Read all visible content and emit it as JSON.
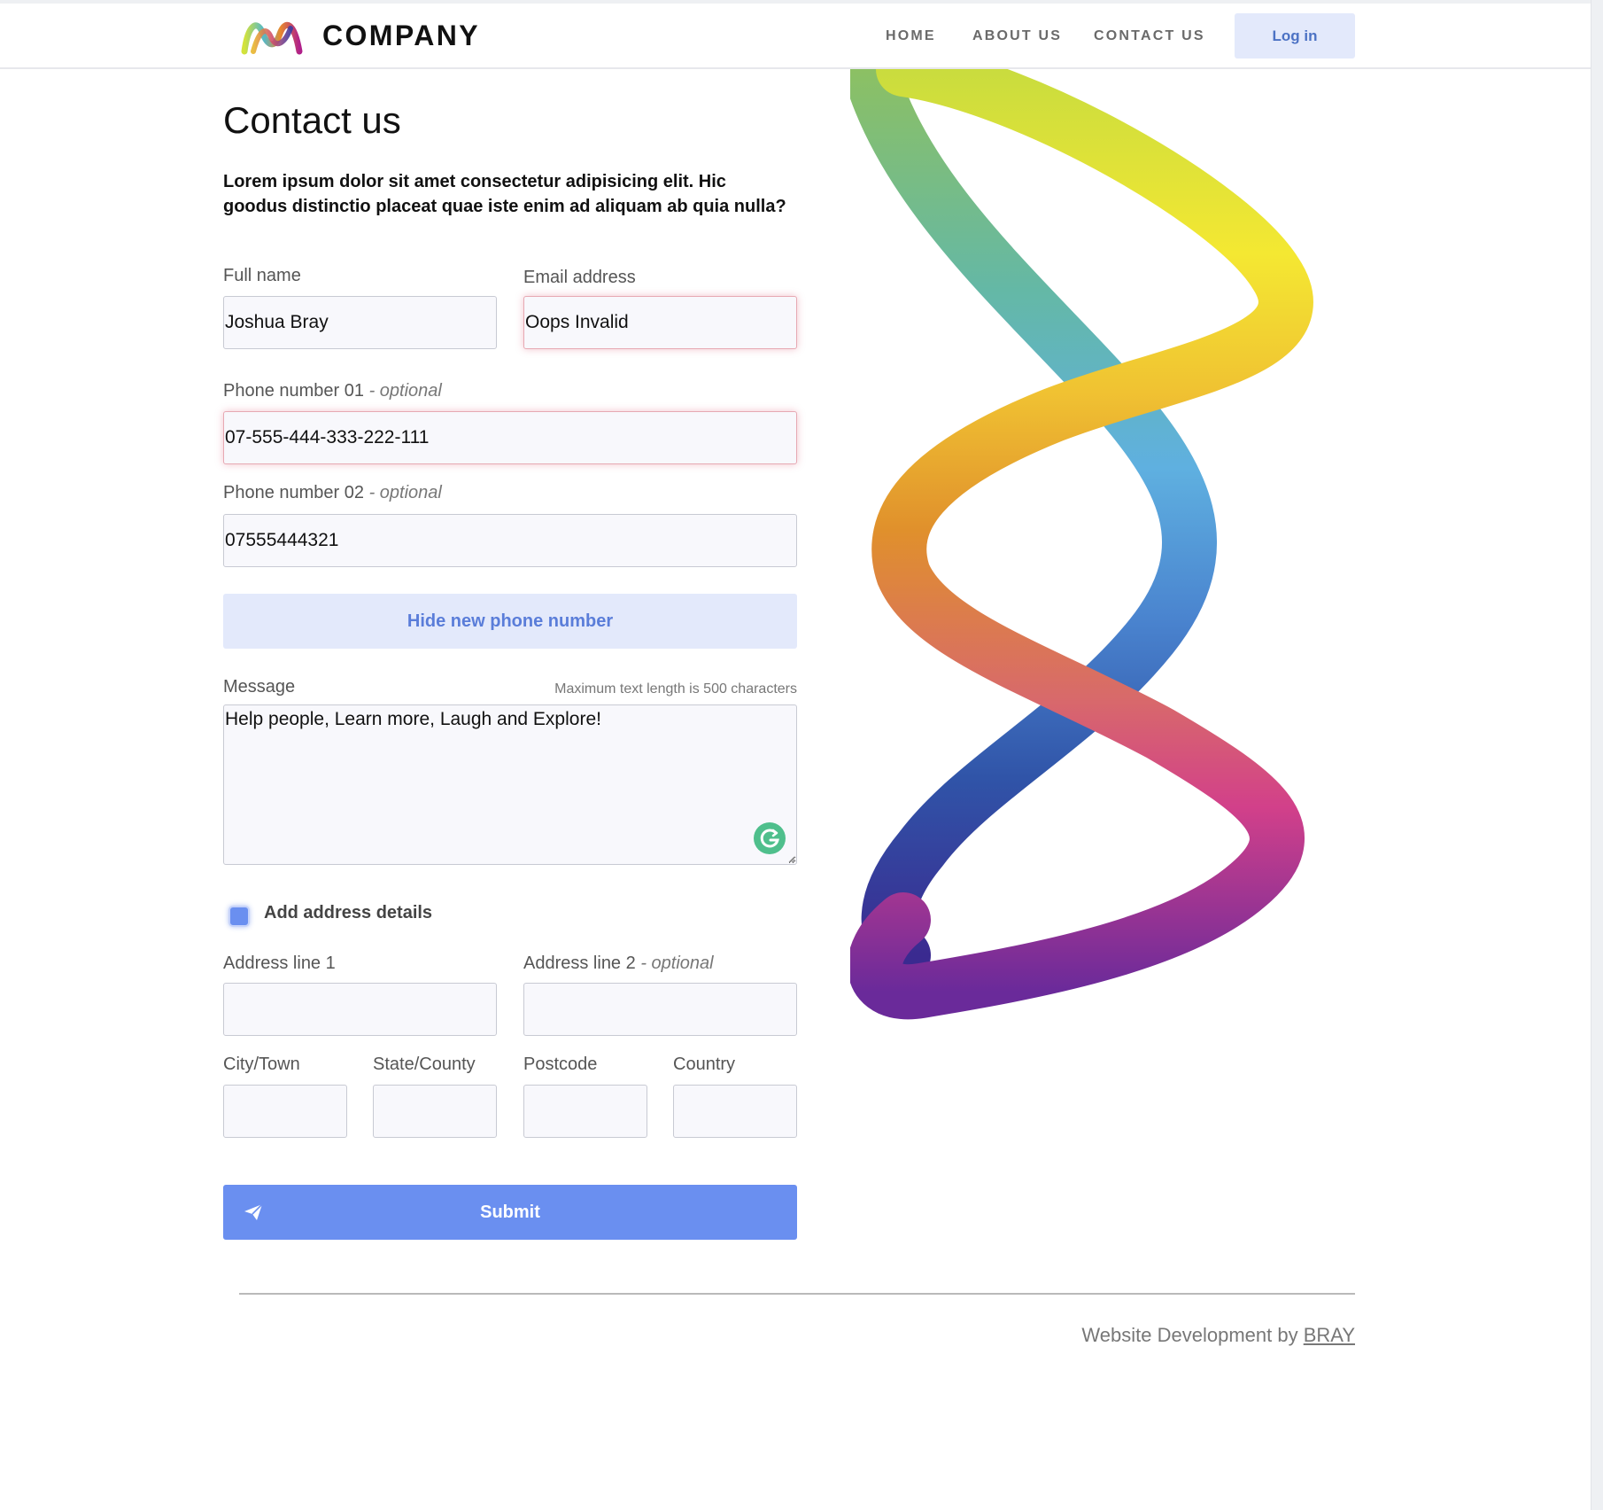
{
  "brand": {
    "name": "COMPANY",
    "colors": {
      "accent": "#6a8ff0",
      "soft_accent": "#e3e9fb",
      "link_text": "#4c72c4",
      "invalid_glow": "#d6506e"
    }
  },
  "nav": {
    "items": [
      {
        "label": "HOME"
      },
      {
        "label": "ABOUT US"
      },
      {
        "label": "CONTACT US"
      }
    ],
    "login_label": "Log in"
  },
  "page": {
    "title": "Contact us",
    "intro": "Lorem ipsum dolor sit amet consectetur adipisicing elit. Hic goodus distinctio placeat quae iste enim ad aliquam ab quia nulla?"
  },
  "form": {
    "full_name": {
      "label": "Full name",
      "value": "Joshua Bray"
    },
    "email": {
      "label": "Email address",
      "value": "Oops Invalid",
      "state": "invalid"
    },
    "optional_suffix": "- optional",
    "phone1": {
      "label": "Phone number 01",
      "value": "07-555-444-333-222-111",
      "state": "invalid"
    },
    "phone2": {
      "label": "Phone number 02",
      "value": "07555444321"
    },
    "hide_phone_label": "Hide new phone number",
    "message": {
      "label": "Message",
      "hint": "Maximum text length is 500 characters",
      "value": "Help people, Learn more, Laugh and Explore!"
    },
    "address_checkbox": {
      "label": "Add address details",
      "checked": true
    },
    "address1": {
      "label": "Address line 1",
      "value": ""
    },
    "address2": {
      "label": "Address line 2",
      "value": ""
    },
    "city": {
      "label": "City/Town",
      "value": ""
    },
    "state": {
      "label": "State/County",
      "value": ""
    },
    "postcode": {
      "label": "Postcode",
      "value": ""
    },
    "country": {
      "label": "Country",
      "value": ""
    },
    "submit_label": "Submit"
  },
  "footer": {
    "text": "Website Development by",
    "link": "BRAY"
  },
  "icons": {
    "logo": "company-logo-icon",
    "grammarly": "grammarly-icon",
    "submit": "paper-plane-icon"
  }
}
